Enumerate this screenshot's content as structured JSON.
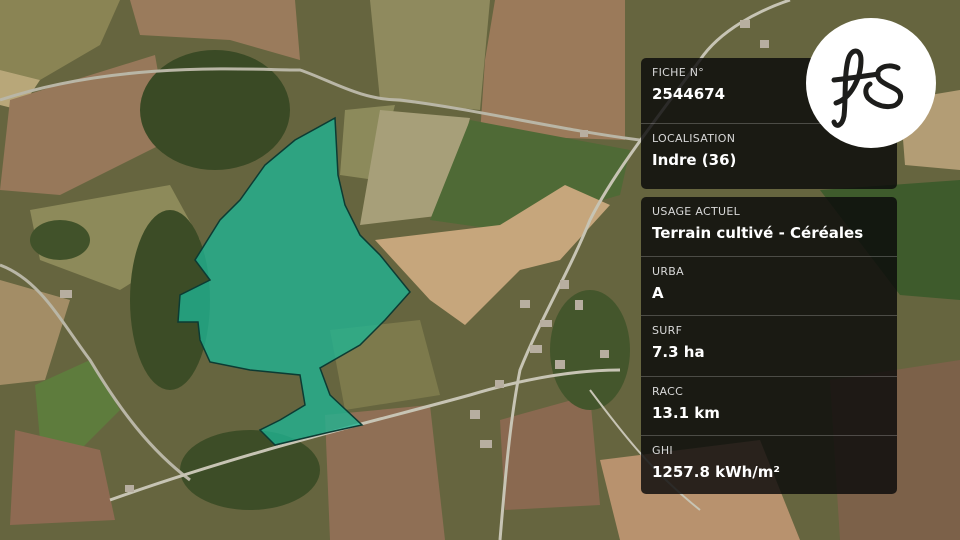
{
  "colors": {
    "parcel_fill": "#1fb594",
    "parcel_stroke": "#0c3b33",
    "panel_bg": "#0a0a0a"
  },
  "logo": {
    "icon": "fs-monogram-logo"
  },
  "fiche": {
    "label": "FICHE N°",
    "value": "2544674"
  },
  "localisation": {
    "label": "LOCALISATION",
    "value": "Indre (36)"
  },
  "usage": {
    "label": "USAGE ACTUEL",
    "value": "Terrain cultivé - Céréales"
  },
  "urba": {
    "label": "URBA",
    "value": "A"
  },
  "surf": {
    "label": "SURF",
    "value": "7.3 ha"
  },
  "racc": {
    "label": "RACC",
    "value": "13.1 km"
  },
  "ghi": {
    "label": "GHI",
    "value": "1257.8 kWh/m²"
  }
}
